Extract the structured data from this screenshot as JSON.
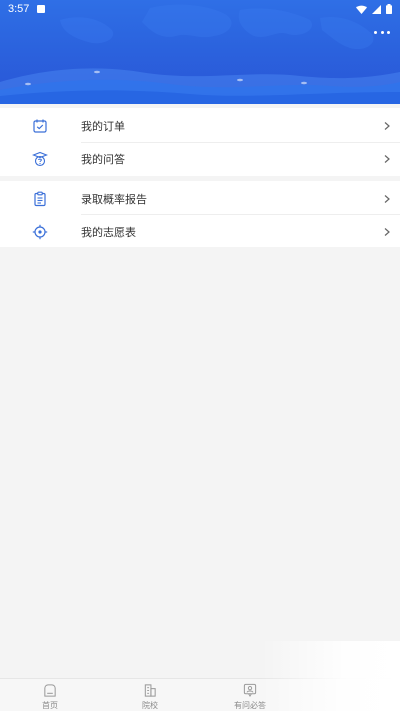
{
  "status_bar": {
    "time": "3:57"
  },
  "menu_groups": [
    {
      "items": [
        {
          "label": "我的订单",
          "icon": "order-check-icon"
        },
        {
          "label": "我的问答",
          "icon": "qa-graduation-icon"
        }
      ]
    },
    {
      "items": [
        {
          "label": "录取概率报告",
          "icon": "clipboard-report-icon"
        },
        {
          "label": "我的志愿表",
          "icon": "target-icon"
        }
      ]
    }
  ],
  "tab_bar": {
    "tabs": [
      {
        "label": "首页",
        "icon": "home-icon"
      },
      {
        "label": "院校",
        "icon": "building-icon"
      },
      {
        "label": "有问必答",
        "icon": "person-qa-icon"
      }
    ]
  },
  "colors": {
    "header_blue": "#2b63de",
    "icon_blue": "#3a6fd8",
    "background": "#f4f4f4"
  }
}
